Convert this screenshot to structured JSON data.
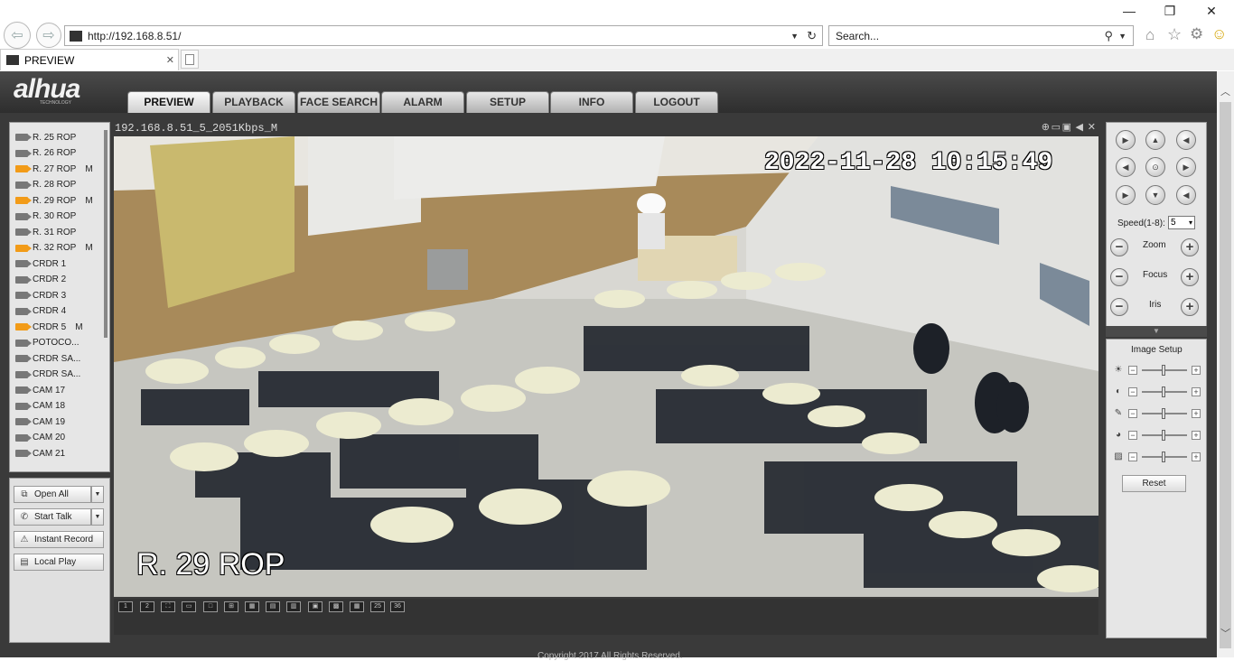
{
  "browser": {
    "address": "http://192.168.8.51/",
    "search_placeholder": "Search...",
    "tab_title": "PREVIEW",
    "tab_close": "✕"
  },
  "app": {
    "logo": "alhua",
    "logo_sub": "TECHNOLOGY",
    "menu": [
      "PREVIEW",
      "PLAYBACK",
      "FACE SEARCH",
      "ALARM",
      "SETUP",
      "INFO",
      "LOGOUT"
    ],
    "active_menu": "PREVIEW",
    "stream_info": "192.168.8.51_5_2051Kbps_M",
    "osd_timestamp": "2022-11-28 10:15:49",
    "osd_channel": "R. 29 ROP",
    "footer_partial": "Copyright 2017 All Rights Reserved."
  },
  "cameras": [
    {
      "label": "R. 25 ROP",
      "active": false,
      "mark": ""
    },
    {
      "label": "R. 26 ROP",
      "active": false,
      "mark": ""
    },
    {
      "label": "R. 27 ROP",
      "active": true,
      "mark": "M"
    },
    {
      "label": "R. 28 ROP",
      "active": false,
      "mark": ""
    },
    {
      "label": "R. 29 ROP",
      "active": true,
      "mark": "M"
    },
    {
      "label": "R. 30 ROP",
      "active": false,
      "mark": ""
    },
    {
      "label": "R. 31 ROP",
      "active": false,
      "mark": ""
    },
    {
      "label": "R. 32 ROP",
      "active": true,
      "mark": "M"
    },
    {
      "label": "CRDR 1",
      "active": false,
      "mark": ""
    },
    {
      "label": "CRDR 2",
      "active": false,
      "mark": ""
    },
    {
      "label": "CRDR 3",
      "active": false,
      "mark": ""
    },
    {
      "label": "CRDR 4",
      "active": false,
      "mark": ""
    },
    {
      "label": "CRDR 5",
      "active": true,
      "mark": "M"
    },
    {
      "label": "POTOCO...",
      "active": false,
      "mark": ""
    },
    {
      "label": "CRDR SA...",
      "active": false,
      "mark": ""
    },
    {
      "label": "CRDR SA...",
      "active": false,
      "mark": ""
    },
    {
      "label": "CAM 17",
      "active": false,
      "mark": ""
    },
    {
      "label": "CAM 18",
      "active": false,
      "mark": ""
    },
    {
      "label": "CAM 19",
      "active": false,
      "mark": ""
    },
    {
      "label": "CAM 20",
      "active": false,
      "mark": ""
    },
    {
      "label": "CAM 21",
      "active": false,
      "mark": ""
    }
  ],
  "actions": {
    "open_all": "Open All",
    "start_talk": "Start Talk",
    "instant_record": "Instant Record",
    "local_play": "Local Play"
  },
  "ptz": {
    "speed_label": "Speed(1-8):",
    "speed_value": "5",
    "zoom": "Zoom",
    "focus": "Focus",
    "iris": "Iris",
    "minus": "−",
    "plus": "+"
  },
  "image_setup": {
    "title": "Image Setup",
    "reset": "Reset",
    "controls": [
      "brightness-icon",
      "contrast-icon",
      "saturation-icon",
      "hue-icon",
      "gain-icon"
    ]
  },
  "layouts": [
    "1",
    "2",
    "⛶",
    "▭",
    "□",
    "⊞",
    "▦",
    "▤",
    "▥",
    "▣",
    "▩",
    "▦",
    "25",
    "36"
  ]
}
